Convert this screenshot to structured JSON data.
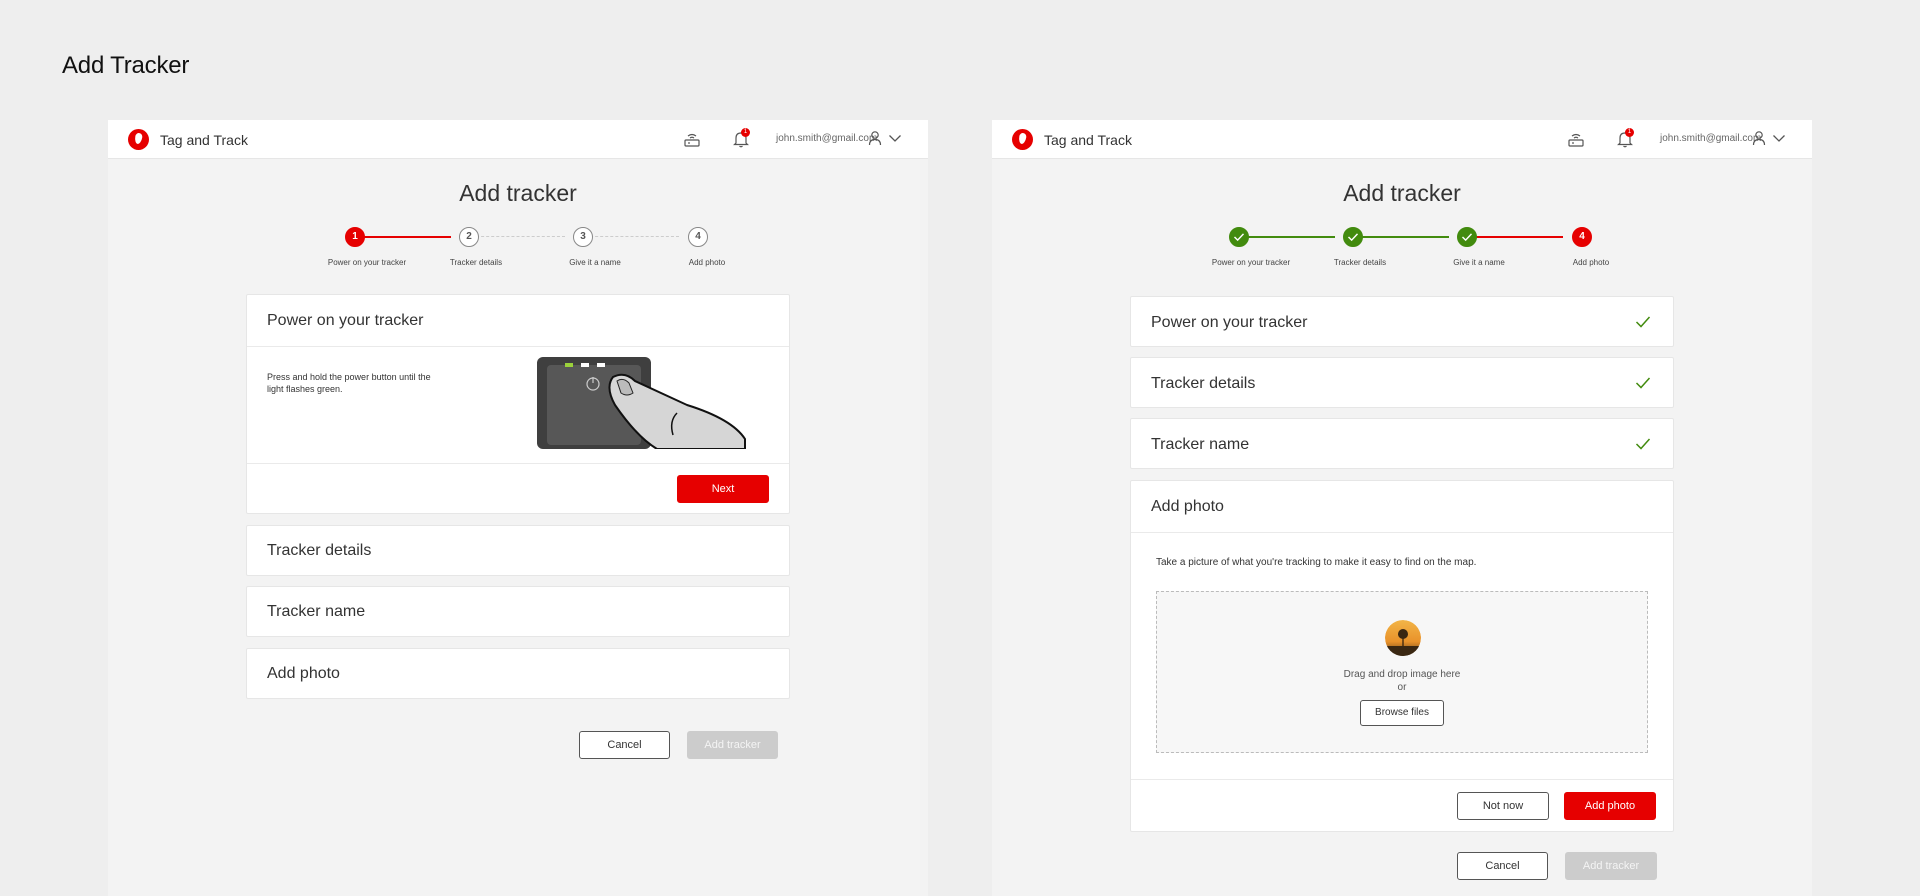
{
  "page_title": "Add Tracker",
  "colors": {
    "brand_red": "#e60000",
    "success_green": "#428b0e",
    "disabled_grey": "#cccccc"
  },
  "header": {
    "app_name": "Tag and Track",
    "notification_count": "1",
    "user_email": "john.smith@gmail.com",
    "icons": [
      "vodafone-logo",
      "router-icon",
      "bell-icon",
      "user-icon",
      "chevron-down-icon"
    ]
  },
  "screen_a": {
    "title": "Add tracker",
    "steps": [
      {
        "number": "1",
        "label": "Power on your tracker",
        "state": "current"
      },
      {
        "number": "2",
        "label": "Tracker details",
        "state": "todo"
      },
      {
        "number": "3",
        "label": "Give it a name",
        "state": "todo"
      },
      {
        "number": "4",
        "label": "Add photo",
        "state": "todo"
      }
    ],
    "sections": [
      {
        "title": "Power on your tracker",
        "expanded": true
      },
      {
        "title": "Tracker details"
      },
      {
        "title": "Tracker name"
      },
      {
        "title": "Add photo"
      }
    ],
    "instructions": "Press and hold the power button until the light flashes green.",
    "next_label": "Next",
    "cancel_label": "Cancel",
    "add_tracker_label": "Add tracker"
  },
  "screen_b": {
    "title": "Add tracker",
    "steps": [
      {
        "number": "1",
        "label": "Power on your tracker",
        "state": "done"
      },
      {
        "number": "2",
        "label": "Tracker details",
        "state": "done"
      },
      {
        "number": "3",
        "label": "Give it a name",
        "state": "done"
      },
      {
        "number": "4",
        "label": "Add photo",
        "state": "current"
      }
    ],
    "sections": [
      {
        "title": "Power on your tracker",
        "completed": true
      },
      {
        "title": "Tracker details",
        "completed": true
      },
      {
        "title": "Tracker name",
        "completed": true
      },
      {
        "title": "Add photo",
        "expanded": true
      }
    ],
    "photo_hint": "Take a picture of what you're tracking to make it easy to find on the map.",
    "drop_text": "Drag and drop image here",
    "or_text": "or",
    "browse_label": "Browse files",
    "not_now_label": "Not now",
    "add_photo_label": "Add photo",
    "cancel_label": "Cancel",
    "add_tracker_label": "Add tracker"
  }
}
